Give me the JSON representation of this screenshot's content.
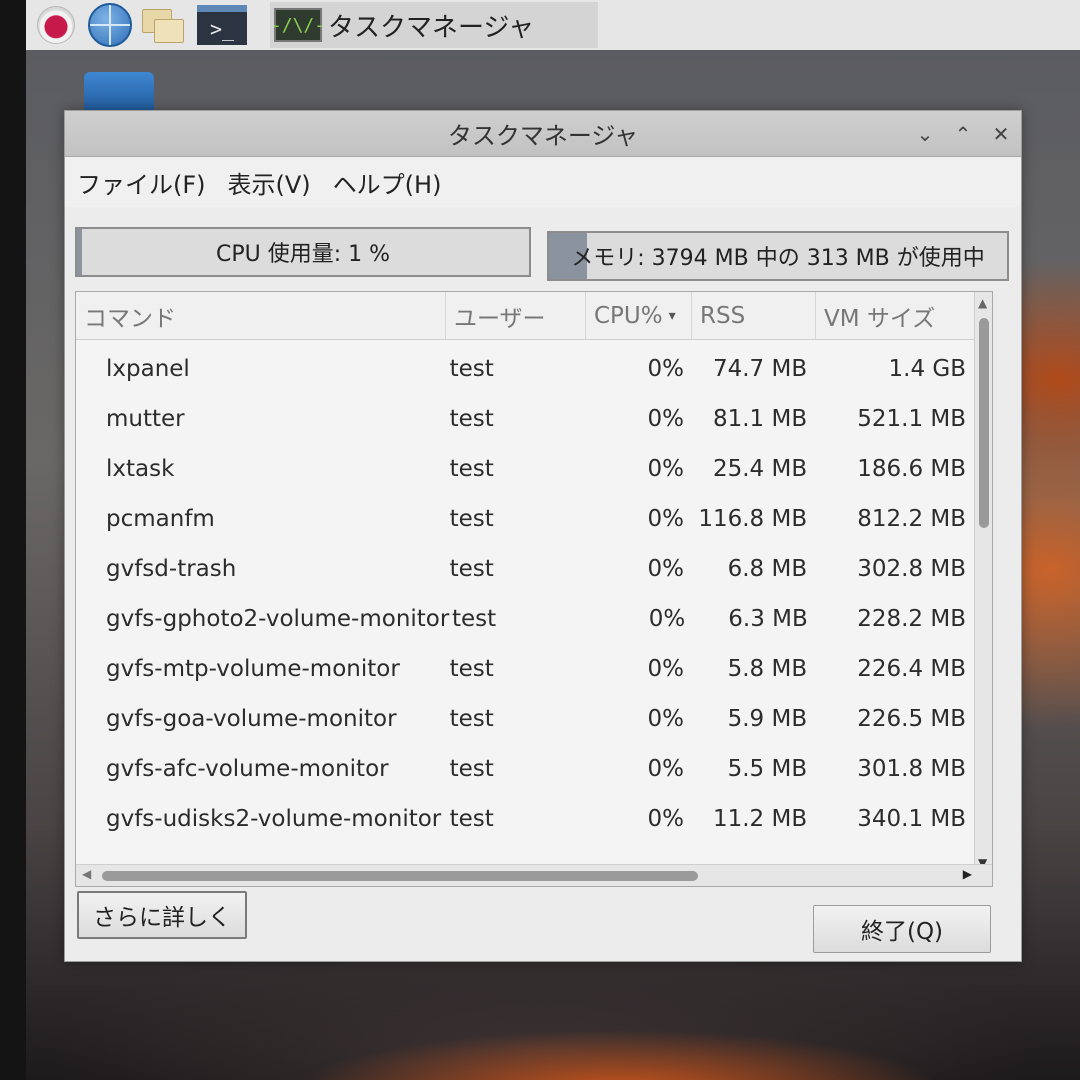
{
  "taskbar": {
    "launchers": [
      {
        "icon": "raspberry-pi-menu-icon"
      },
      {
        "icon": "web-browser-globe-icon"
      },
      {
        "icon": "file-manager-folders-icon"
      },
      {
        "icon": "terminal-icon",
        "glyph": ">_"
      }
    ],
    "task_button": {
      "icon": "task-manager-graph-icon",
      "glyph": "-/\\/-",
      "label": "タスクマネージャ"
    }
  },
  "window": {
    "title": "タスクマネージャ",
    "controls": {
      "minimize": "⌄",
      "maximize": "⌃",
      "close": "✕"
    },
    "menu": [
      "ファイル(F)",
      "表示(V)",
      "ヘルプ(H)"
    ],
    "cpu_meter": {
      "label": "CPU 使用量: 1 %",
      "percent": 1
    },
    "memory_meter": {
      "label": "メモリ: 3794 MB 中の 313 MB が使用中",
      "used_mb": 313,
      "total_mb": 3794
    },
    "columns": [
      "コマンド",
      "ユーザー",
      "CPU%",
      "RSS",
      "VM サイズ"
    ],
    "sort_indicator": "▾",
    "processes": [
      {
        "command": "lxpanel",
        "user": "test",
        "cpu": "0%",
        "rss": "74.7 MB",
        "vm": "1.4 GB"
      },
      {
        "command": "mutter",
        "user": "test",
        "cpu": "0%",
        "rss": "81.1 MB",
        "vm": "521.1 MB"
      },
      {
        "command": "lxtask",
        "user": "test",
        "cpu": "0%",
        "rss": "25.4 MB",
        "vm": "186.6 MB"
      },
      {
        "command": "pcmanfm",
        "user": "test",
        "cpu": "0%",
        "rss": "116.8 MB",
        "vm": "812.2 MB"
      },
      {
        "command": "gvfsd-trash",
        "user": "test",
        "cpu": "0%",
        "rss": "6.8 MB",
        "vm": "302.8 MB"
      },
      {
        "command": "gvfs-gphoto2-volume-monitor",
        "user": "test",
        "cpu": "0%",
        "rss": "6.3 MB",
        "vm": "228.2 MB"
      },
      {
        "command": "gvfs-mtp-volume-monitor",
        "user": "test",
        "cpu": "0%",
        "rss": "5.8 MB",
        "vm": "226.4 MB"
      },
      {
        "command": "gvfs-goa-volume-monitor",
        "user": "test",
        "cpu": "0%",
        "rss": "5.9 MB",
        "vm": "226.5 MB"
      },
      {
        "command": "gvfs-afc-volume-monitor",
        "user": "test",
        "cpu": "0%",
        "rss": "5.5 MB",
        "vm": "301.8 MB"
      },
      {
        "command": "gvfs-udisks2-volume-monitor",
        "user": "test",
        "cpu": "0%",
        "rss": "11.2 MB",
        "vm": "340.1 MB"
      }
    ],
    "buttons": {
      "more": "さらに詳しく",
      "quit": "終了(Q)"
    }
  }
}
